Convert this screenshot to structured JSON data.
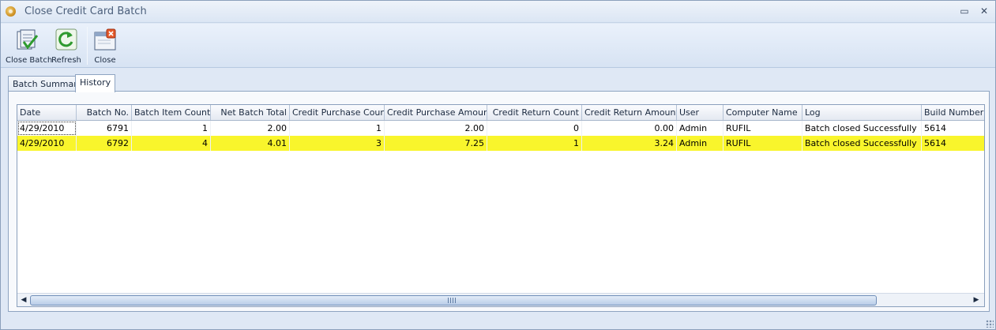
{
  "window": {
    "title": "Close Credit Card Batch"
  },
  "titlebar_buttons": {
    "restore": "▭",
    "close": "✕"
  },
  "toolbar": {
    "close_batch": "Close Batch",
    "refresh": "Refresh",
    "close": "Close"
  },
  "tabs": [
    {
      "label": "Batch Summary",
      "active": false
    },
    {
      "label": "History",
      "active": true
    }
  ],
  "grid": {
    "columns": [
      "Date",
      "Batch No.",
      "Batch Item Count",
      "Net Batch Total",
      "Credit Purchase Count",
      "Credit Purchase Amount",
      "Credit Return Count",
      "Credit Return Amount",
      "User",
      "Computer Name",
      "Log",
      "Build Number"
    ],
    "rows": [
      [
        "4/29/2010",
        "6791",
        "1",
        "2.00",
        "1",
        "2.00",
        "0",
        "0.00",
        "Admin",
        "RUFIL",
        "Batch closed Successfully",
        "5614"
      ],
      [
        "4/29/2010",
        "6792",
        "4",
        "4.01",
        "3",
        "7.25",
        "1",
        "3.24",
        "Admin",
        "RUFIL",
        "Batch closed Successfully",
        "5614"
      ]
    ],
    "selected_row_index": 1,
    "selected_row_color": "#f9f52c"
  },
  "scrollbar": {
    "left_arrow": "◀",
    "right_arrow": "▶"
  }
}
